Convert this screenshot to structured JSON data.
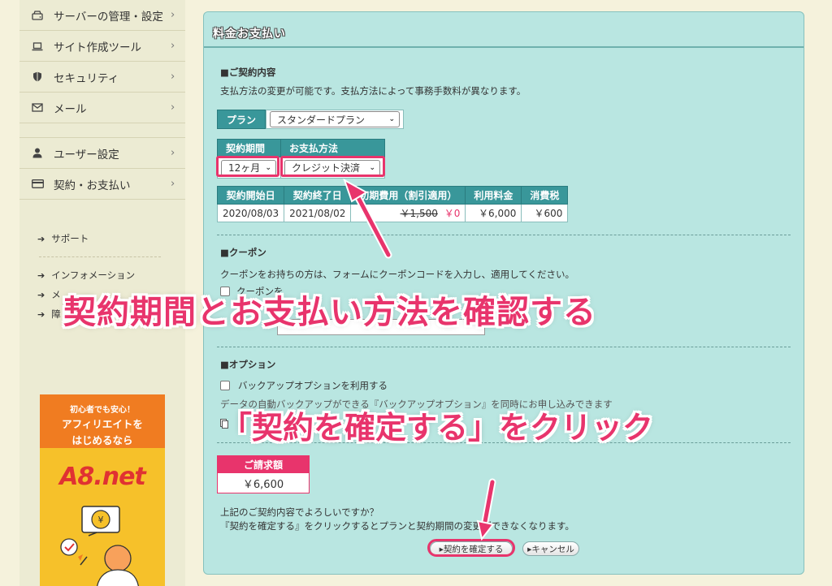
{
  "sidebar": {
    "items": [
      {
        "label": "サーバーの管理・設定",
        "icon": "server-icon"
      },
      {
        "label": "サイト作成ツール",
        "icon": "laptop-icon"
      },
      {
        "label": "セキュリティ",
        "icon": "shield-icon"
      },
      {
        "label": "メール",
        "icon": "mail-icon"
      },
      {
        "label": "ユーザー設定",
        "icon": "user-icon"
      },
      {
        "label": "契約・お支払い",
        "icon": "credit-card-icon"
      }
    ],
    "chevron": "›",
    "support_link": "サポート",
    "links": [
      "インフォメーション",
      "メ",
      "障"
    ],
    "link_arrow": "➔"
  },
  "ad": {
    "line1": "初心者でも安心！",
    "line2": "アフィリエイトを",
    "line3": "はじめるなら",
    "logo": "A8.net",
    "coin": "¥"
  },
  "main": {
    "title": "料金お支払い",
    "contract": {
      "title": "■ご契約内容",
      "desc": "支払方法の変更が可能です。支払方法によって事務手数料が異なります。",
      "plan_label": "プラン",
      "plan_value": "スタンダードプラン",
      "period_header": "契約期間",
      "payment_header": "お支払方法",
      "period_value": "12ヶ月",
      "payment_value": "クレジット決済",
      "table": {
        "headers": [
          "契約開始日",
          "契約終了日",
          "初期費用（割引適用）",
          "利用料金",
          "消費税"
        ],
        "start": "2020/08/03",
        "end": "2021/08/02",
        "initial_original": "￥1,500",
        "initial_discount": "￥0",
        "fee": "￥6,000",
        "tax": "￥600"
      }
    },
    "coupon": {
      "title": "■クーポン",
      "desc": "クーポンをお持ちの方は、フォームにクーポンコードを入力し、適用してください。",
      "checkbox_label": "クーポンを"
    },
    "option": {
      "title": "■オプション",
      "checkbox_label": "バックアップオプションを利用する",
      "desc": "データの自動バックアップができる『バックアップオプション』を同時にお申し込みできます"
    },
    "invoice": {
      "label": "ご請求額",
      "amount": "￥6,600"
    },
    "confirm": {
      "line1": "上記のご契約内容でよろしいですか？",
      "line2": "『契約を確定する』をクリックするとプランと契約期間の変更ができなくなります。"
    },
    "buttons": {
      "confirm": "▸契約を確定する",
      "cancel": "▸キャンセル"
    }
  },
  "annotations": {
    "headline1": "契約期間とお支払い方法を確認する",
    "headline2": "「契約を確定する」をクリック"
  },
  "colors": {
    "accent": "#e8346c",
    "panel": "#b9e6e1",
    "table_header": "#39979a"
  }
}
